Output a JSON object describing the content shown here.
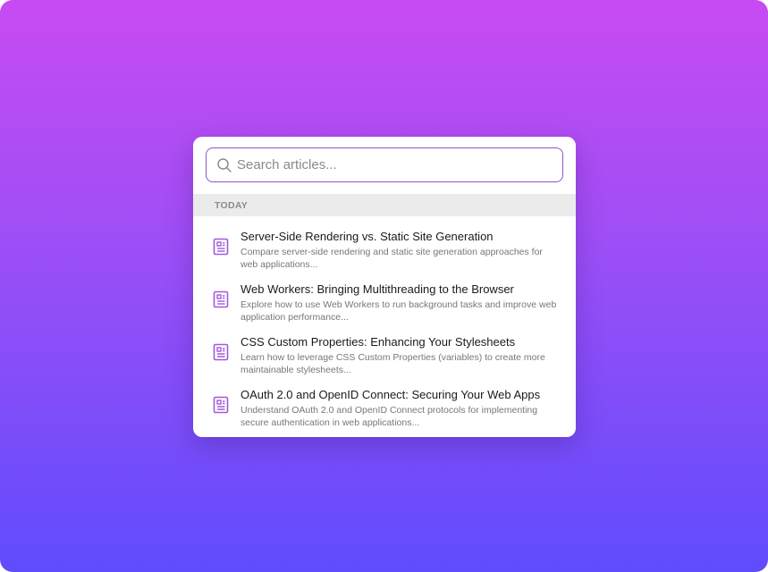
{
  "search": {
    "placeholder": "Search articles...",
    "value": ""
  },
  "groups": [
    {
      "label": "TODAY",
      "results": [
        {
          "title": "Server-Side Rendering vs. Static Site Generation",
          "description": "Compare server-side rendering and static site generation approaches for web applications..."
        },
        {
          "title": "Web Workers: Bringing Multithreading to the Browser",
          "description": "Explore how to use Web Workers to run background tasks and improve web application performance..."
        },
        {
          "title": "CSS Custom Properties: Enhancing Your Stylesheets",
          "description": "Learn how to leverage CSS Custom Properties (variables) to create more maintainable stylesheets..."
        },
        {
          "title": "OAuth 2.0 and OpenID Connect: Securing Your Web Apps",
          "description": "Understand OAuth 2.0 and OpenID Connect protocols for implementing secure authentication in web applications..."
        }
      ]
    }
  ],
  "icons": {
    "search": "search-icon",
    "result": "article-icon"
  },
  "colors": {
    "background_top": "#c84bf2",
    "background_bottom": "#604cfd",
    "accent": "#8f55c9",
    "icon": "#a259d9",
    "group_header_bg": "#ebebeb"
  }
}
